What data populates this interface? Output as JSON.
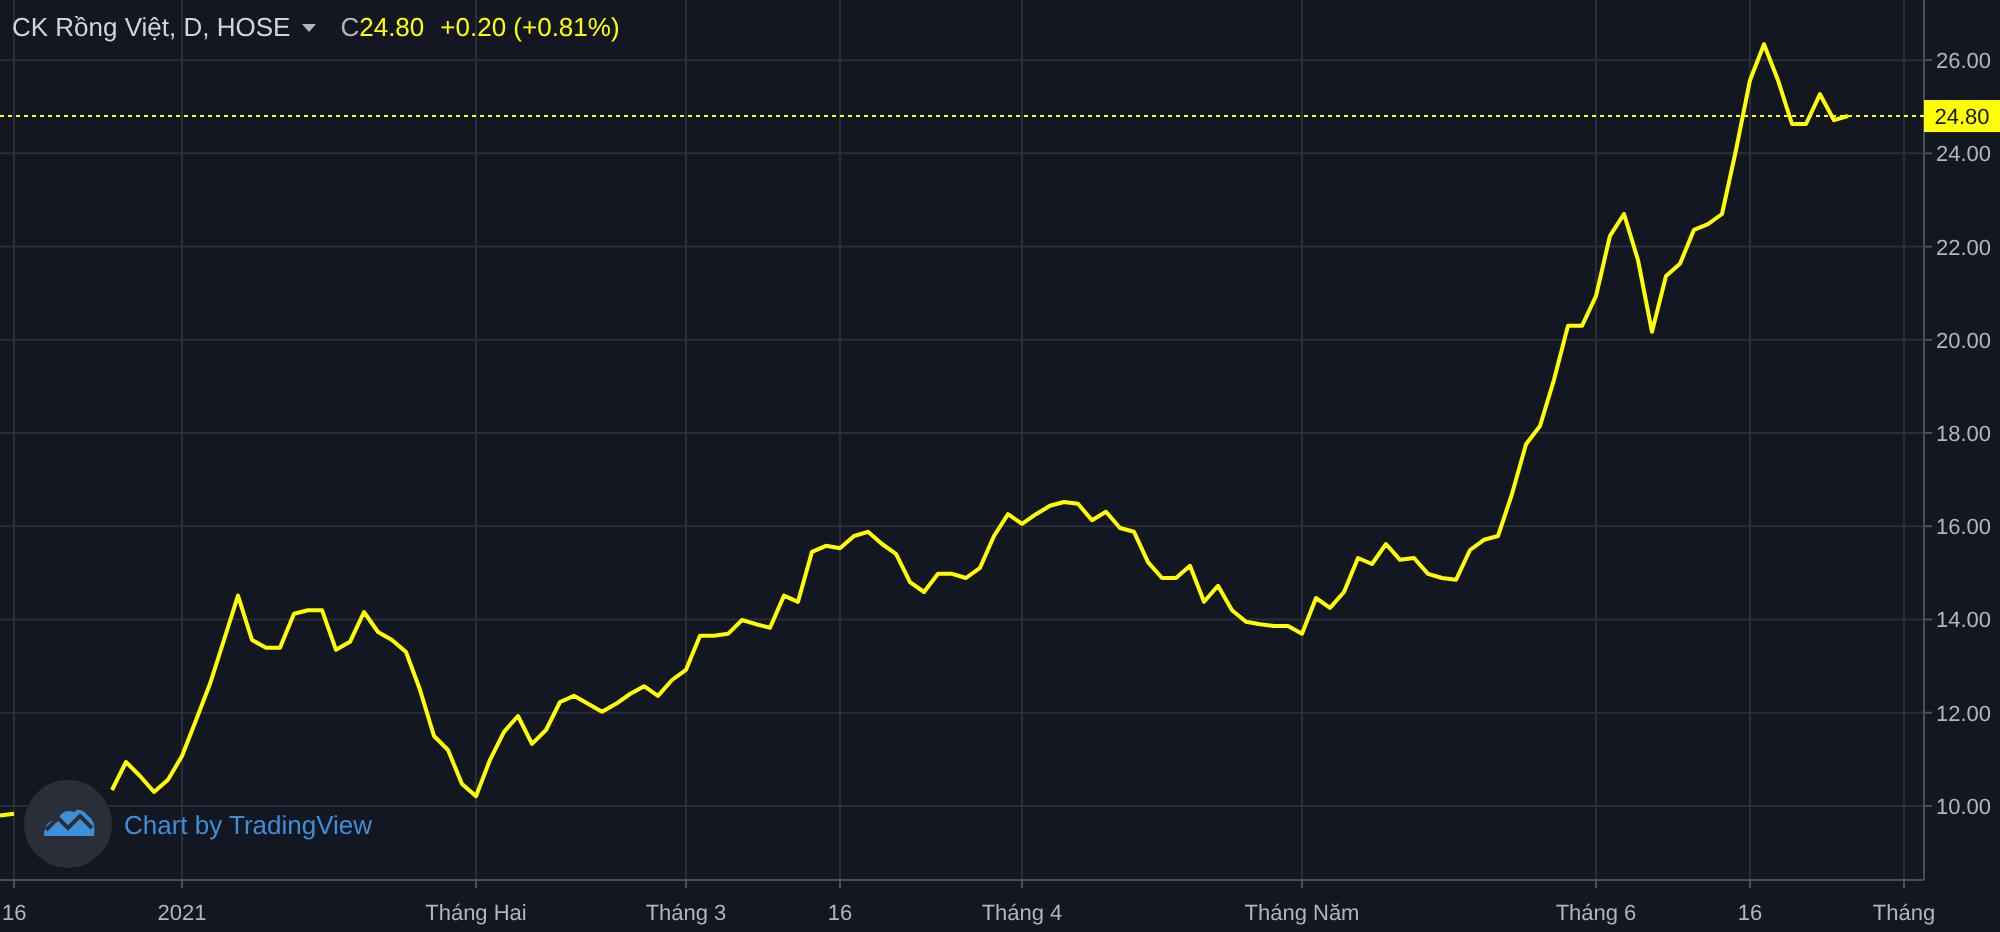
{
  "legend": {
    "symbol": "CK Rồng Việt, D, HOSE",
    "close_label": "C",
    "close_value": "24.80",
    "change": "+0.20 (+0.81%)"
  },
  "price_tag": "24.80",
  "attribution": "Chart by TradingView",
  "chart_data": {
    "type": "line",
    "categories": [
      null,
      "16",
      null,
      null,
      null,
      null,
      null,
      null,
      null,
      null,
      null,
      null,
      null,
      "2021",
      null,
      null,
      null,
      null,
      null,
      null,
      null,
      null,
      null,
      null,
      null,
      null,
      null,
      null,
      null,
      null,
      null,
      null,
      null,
      null,
      "Tháng Hai",
      null,
      null,
      null,
      null,
      null,
      null,
      null,
      null,
      null,
      null,
      null,
      null,
      null,
      null,
      "Tháng 3",
      null,
      null,
      null,
      null,
      null,
      null,
      null,
      null,
      null,
      null,
      "16",
      null,
      null,
      null,
      null,
      null,
      null,
      null,
      null,
      null,
      null,
      null,
      null,
      "Tháng 4",
      null,
      null,
      null,
      null,
      null,
      null,
      null,
      null,
      null,
      null,
      null,
      null,
      null,
      null,
      null,
      null,
      null,
      null,
      null,
      "Tháng Năm",
      null,
      null,
      null,
      null,
      null,
      null,
      null,
      null,
      null,
      null,
      null,
      null,
      null,
      null,
      null,
      null,
      null,
      null,
      null,
      null,
      "Tháng 6",
      null,
      null,
      null,
      null,
      null,
      null,
      null,
      null,
      null,
      null,
      "16",
      null,
      null,
      null,
      null,
      null,
      null,
      null,
      null,
      null,
      null,
      "Tháng"
    ],
    "series": [
      {
        "color": "#ffff00",
        "values": [
          9.79,
          9.83,
          null,
          null,
          null,
          null,
          null,
          null,
          10.34,
          10.94,
          10.64,
          10.3,
          10.56,
          11.07,
          11.84,
          12.62,
          13.56,
          14.51,
          13.56,
          13.39,
          13.39,
          14.12,
          14.2,
          14.2,
          13.35,
          13.52,
          14.16,
          13.73,
          13.56,
          13.3,
          12.49,
          11.5,
          11.2,
          10.47,
          10.21,
          10.99,
          11.59,
          11.93,
          11.33,
          11.63,
          12.23,
          12.36,
          12.19,
          12.02,
          12.19,
          12.4,
          12.57,
          12.36,
          12.7,
          12.92,
          13.65,
          13.65,
          13.69,
          13.99,
          13.9,
          13.82,
          14.51,
          14.38,
          15.45,
          15.58,
          15.53,
          15.79,
          15.88,
          15.62,
          15.41,
          14.8,
          14.59,
          14.98,
          14.98,
          14.89,
          15.11,
          15.79,
          16.26,
          16.05,
          16.26,
          16.44,
          16.52,
          16.48,
          16.13,
          16.31,
          15.96,
          15.88,
          15.23,
          14.89,
          14.89,
          15.15,
          14.38,
          14.72,
          14.2,
          13.95,
          13.9,
          13.86,
          13.86,
          13.69,
          14.46,
          14.25,
          14.59,
          15.32,
          15.19,
          15.62,
          15.28,
          15.32,
          14.98,
          14.89,
          14.85,
          15.49,
          15.71,
          15.79,
          16.69,
          17.76,
          18.15,
          19.14,
          20.3,
          20.3,
          20.94,
          22.23,
          22.7,
          21.71,
          20.17,
          21.37,
          21.63,
          22.36,
          22.48,
          22.7,
          24.07,
          25.57,
          26.34,
          25.57,
          24.63,
          24.63,
          25.27,
          24.71,
          24.8,
          null,
          null,
          null,
          null
        ]
      }
    ],
    "ylim": [
      8.41,
      27.29
    ],
    "grid": true,
    "ref_lines": [
      {
        "axis": "y",
        "value": 24.8,
        "color": "#ffff00"
      }
    ],
    "yticks": [
      {
        "value": 10,
        "label": "10.00"
      },
      {
        "value": 12,
        "label": "12.00"
      },
      {
        "value": 14,
        "label": "14.00"
      },
      {
        "value": 16,
        "label": "16.00"
      },
      {
        "value": 18,
        "label": "18.00"
      },
      {
        "value": 20,
        "label": "20.00"
      },
      {
        "value": 22,
        "label": "22.00"
      },
      {
        "value": 24,
        "label": "24.00"
      },
      {
        "value": 26,
        "label": "26.00"
      }
    ]
  }
}
